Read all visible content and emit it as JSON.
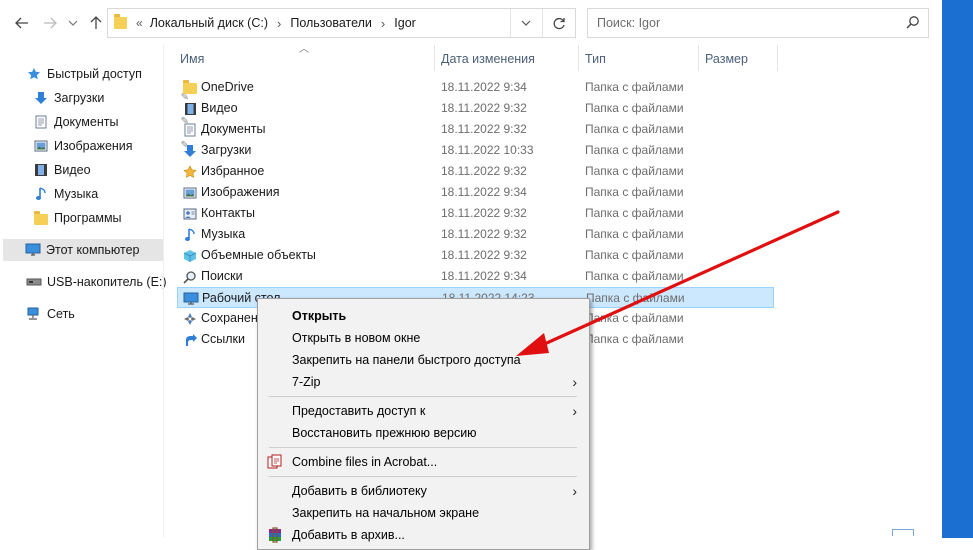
{
  "nav": {
    "back_icon": "arrow-left-icon",
    "forward_icon": "arrow-right-icon",
    "recent_icon": "chevron-down-icon",
    "up_icon": "arrow-up-icon",
    "address_overflow": "«",
    "address_crumbs": [
      "Локальный диск (C:)",
      "Пользователи",
      "Igor"
    ],
    "search_placeholder": "Поиск: Igor"
  },
  "sidebar": {
    "items": [
      {
        "label": "Быстрый доступ",
        "icon": "star-icon",
        "pinned": false
      },
      {
        "label": "Загрузки",
        "icon": "download-arrow-icon",
        "pinned": true
      },
      {
        "label": "Документы",
        "icon": "document-icon",
        "pinned": true
      },
      {
        "label": "Изображения",
        "icon": "pictures-icon",
        "pinned": true
      },
      {
        "label": "Видео",
        "icon": "film-icon",
        "pinned": false
      },
      {
        "label": "Музыка",
        "icon": "music-note-icon",
        "pinned": false
      },
      {
        "label": "Программы",
        "icon": "folder-icon",
        "pinned": false
      },
      {
        "label": "Этот компьютер",
        "icon": "computer-icon",
        "pinned": false
      },
      {
        "label": "USB-накопитель (E:)",
        "icon": "usb-drive-icon",
        "pinned": false
      },
      {
        "label": "Сеть",
        "icon": "network-icon",
        "pinned": false
      }
    ]
  },
  "columns": {
    "name": "Имя",
    "date": "Дата изменения",
    "type": "Тип",
    "size": "Размер"
  },
  "files": [
    {
      "name": "OneDrive",
      "date": "18.11.2022 9:34",
      "type": "Папка с файлами",
      "icon": "folder-icon"
    },
    {
      "name": "Видео",
      "date": "18.11.2022 9:32",
      "type": "Папка с файлами",
      "icon": "film-icon"
    },
    {
      "name": "Документы",
      "date": "18.11.2022 9:32",
      "type": "Папка с файлами",
      "icon": "document-icon"
    },
    {
      "name": "Загрузки",
      "date": "18.11.2022 10:33",
      "type": "Папка с файлами",
      "icon": "download-arrow-icon"
    },
    {
      "name": "Избранное",
      "date": "18.11.2022 9:32",
      "type": "Папка с файлами",
      "icon": "star-icon"
    },
    {
      "name": "Изображения",
      "date": "18.11.2022 9:34",
      "type": "Папка с файлами",
      "icon": "pictures-icon"
    },
    {
      "name": "Контакты",
      "date": "18.11.2022 9:32",
      "type": "Папка с файлами",
      "icon": "contacts-icon"
    },
    {
      "name": "Музыка",
      "date": "18.11.2022 9:32",
      "type": "Папка с файлами",
      "icon": "music-note-icon"
    },
    {
      "name": "Объемные объекты",
      "date": "18.11.2022 9:32",
      "type": "Папка с файлами",
      "icon": "cube-icon"
    },
    {
      "name": "Поиски",
      "date": "18.11.2022 9:34",
      "type": "Папка с файлами",
      "icon": "search-icon"
    },
    {
      "name": "Рабочий стол",
      "date": "18.11.2022 14:23",
      "type": "Папка с файлами",
      "icon": "desktop-icon"
    },
    {
      "name": "Сохранен",
      "date": "",
      "type": "Папка с файлами",
      "icon": "saved-games-icon"
    },
    {
      "name": "Ссылки",
      "date": "",
      "type": "Папка с файлами",
      "icon": "link-arrow-icon"
    }
  ],
  "context_menu": {
    "items": [
      {
        "label": "Открыть",
        "bold": true,
        "submenu": false
      },
      {
        "label": "Открыть в новом окне",
        "bold": false,
        "submenu": false
      },
      {
        "label": "Закрепить на панели быстрого доступа",
        "bold": false,
        "submenu": false
      },
      {
        "label": "7-Zip",
        "bold": false,
        "submenu": true
      },
      {
        "label": "Предоставить доступ к",
        "bold": false,
        "submenu": true
      },
      {
        "label": "Восстановить прежнюю версию",
        "bold": false,
        "submenu": false
      },
      {
        "label": "Combine files in Acrobat...",
        "bold": false,
        "submenu": false,
        "icon": "acrobat-combine-icon"
      },
      {
        "label": "Добавить в библиотеку",
        "bold": false,
        "submenu": true
      },
      {
        "label": "Закрепить на начальном экране",
        "bold": false,
        "submenu": false
      },
      {
        "label": "Добавить в архив...",
        "bold": false,
        "submenu": false,
        "icon": "winrar-icon"
      }
    ]
  },
  "annotation": {
    "arrow_color": "#e01010",
    "arrow_icon": "red-annotation-arrow"
  },
  "colors": {
    "selection_bg": "#cce8ff",
    "selection_border": "#99d1ff",
    "desktop_blue": "#1a6fd0",
    "header_text": "#4c607a"
  }
}
